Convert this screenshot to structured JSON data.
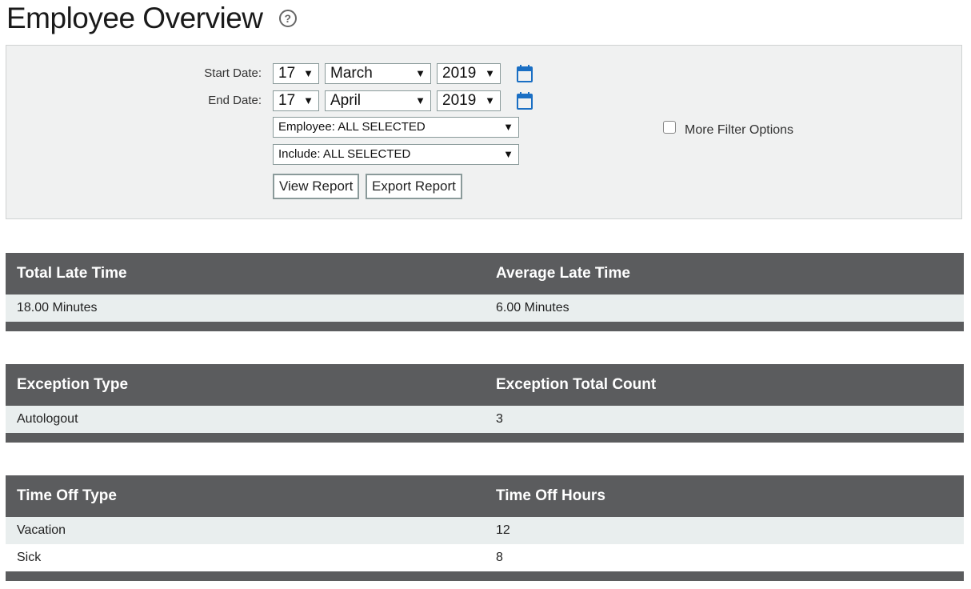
{
  "page": {
    "title": "Employee Overview",
    "help_glyph": "?"
  },
  "filters": {
    "start_label": "Start Date:",
    "end_label": "End Date:",
    "start": {
      "day": "17",
      "month": "March",
      "year": "2019"
    },
    "end": {
      "day": "17",
      "month": "April",
      "year": "2019"
    },
    "employee": "Employee: ALL SELECTED",
    "include": "Include: ALL SELECTED",
    "view_button": "View Report",
    "export_button": "Export Report",
    "more_options_label": "More Filter Options",
    "more_options_checked": false,
    "arrow": "▼"
  },
  "late_time": {
    "headers": [
      "Total Late Time",
      "Average Late Time"
    ],
    "rows": [
      [
        "18.00 Minutes",
        "6.00 Minutes"
      ]
    ]
  },
  "exceptions": {
    "headers": [
      "Exception Type",
      "Exception Total Count"
    ],
    "rows": [
      [
        "Autologout",
        "3"
      ]
    ]
  },
  "time_off": {
    "headers": [
      "Time Off Type",
      "Time Off Hours"
    ],
    "rows": [
      [
        "Vacation",
        "12"
      ],
      [
        "Sick",
        "8"
      ]
    ]
  },
  "colors": {
    "header_bg": "#5b5c5e",
    "row_alt": "#e9eeee",
    "calendar_blue": "#1a6fc4"
  }
}
